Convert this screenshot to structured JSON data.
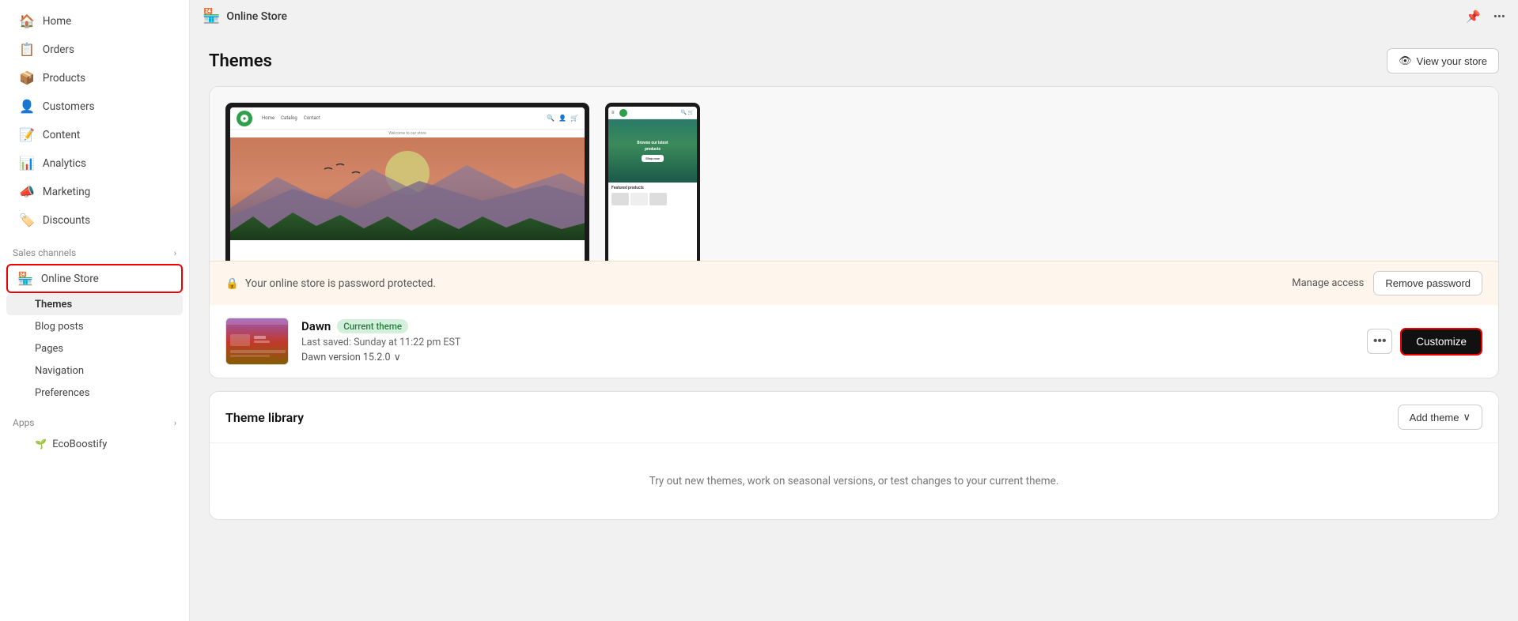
{
  "topbar": {
    "icon": "🏪",
    "title": "Online Store",
    "pin_icon": "📌",
    "more_icon": "···"
  },
  "sidebar": {
    "nav_items": [
      {
        "id": "home",
        "label": "Home",
        "icon": "🏠"
      },
      {
        "id": "orders",
        "label": "Orders",
        "icon": "📋"
      },
      {
        "id": "products",
        "label": "Products",
        "icon": "📦"
      },
      {
        "id": "customers",
        "label": "Customers",
        "icon": "👤"
      },
      {
        "id": "content",
        "label": "Content",
        "icon": "📝"
      },
      {
        "id": "analytics",
        "label": "Analytics",
        "icon": "📊"
      },
      {
        "id": "marketing",
        "label": "Marketing",
        "icon": "📣"
      },
      {
        "id": "discounts",
        "label": "Discounts",
        "icon": "🏷️"
      }
    ],
    "sales_channels_label": "Sales channels",
    "online_store_label": "Online Store",
    "sub_items": [
      {
        "id": "themes",
        "label": "Themes"
      },
      {
        "id": "blog-posts",
        "label": "Blog posts"
      },
      {
        "id": "pages",
        "label": "Pages"
      },
      {
        "id": "navigation",
        "label": "Navigation"
      },
      {
        "id": "preferences",
        "label": "Preferences"
      }
    ],
    "apps_label": "Apps",
    "apps_items": [
      {
        "id": "ecoboostify",
        "label": "EcoBoostify"
      }
    ]
  },
  "main": {
    "page_title": "Themes",
    "view_store_label": "View your store",
    "password_banner": {
      "icon": "🔒",
      "message": "Your online store is password protected.",
      "manage_access": "Manage access",
      "remove_password": "Remove password"
    },
    "current_theme": {
      "name": "Dawn",
      "badge": "Current theme",
      "saved": "Last saved: Sunday at 11:22 pm EST",
      "version": "Dawn version 15.2.0",
      "customize_label": "Customize"
    },
    "theme_library": {
      "title": "Theme library",
      "add_theme_label": "Add theme",
      "empty_message": "Try out new themes, work on seasonal versions, or test changes to your current theme."
    }
  }
}
